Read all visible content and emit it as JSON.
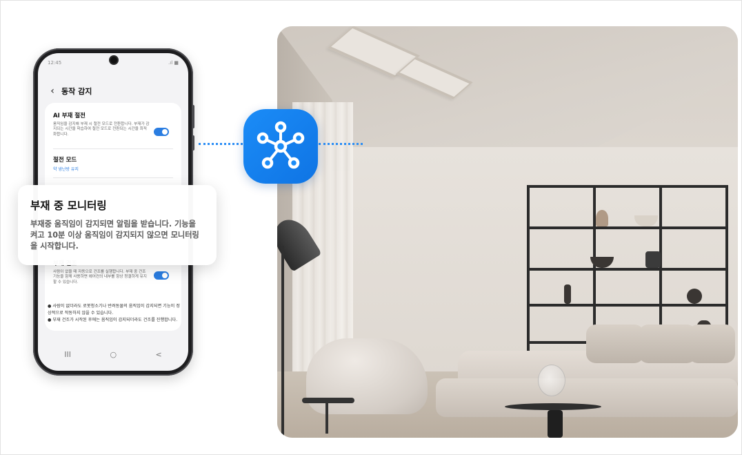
{
  "phone": {
    "status_time": "12:45",
    "status_icons": ".ıl ■",
    "header_title": "동작 감지",
    "ai_saving": {
      "title": "AI 부재 절전",
      "desc": "움직임을 감지해 부재 시 절전 모드로 전환합니다. 부재가 감지되는 시간을 학습하여 절전 모드로 전환되는 시간을 최적화합니다.",
      "toggle_on": true
    },
    "saving_mode": {
      "title": "절전 모드",
      "sub": "약 냉난방 유지"
    },
    "auto_dry": {
      "title": "부재 건조",
      "desc": "사람이 없을 때 자동으로 건조를 실행합니다. 부재 중 건조 기능을 함께 사용하면 에어컨의 내부를 항상 청결하게 유지할 수 있습니다.",
      "toggle_on": true
    },
    "notes": [
      "● 사람이 없더라도 로봇청소기나 반려동물의 움직임이 감지되면 기능이 정상적으로 작동하지 않을 수 있습니다.",
      "● 부재 건조가 시작된 후에는 움직임이 감지되더라도 건조를 진행합니다."
    ],
    "nav": {
      "recent": "III",
      "home": "○",
      "back": "<"
    }
  },
  "callout": {
    "title": "부재 중 모니터링",
    "body": "부재중 움직임이 감지되면 알림을 받습니다. 기능을 켜고 10분 이상 움직임이 감지되지 않으면 모니터링을 시작합니다."
  },
  "icons": {
    "hub": "smartthings-hub-icon",
    "back": "chevron-left-icon"
  },
  "colors": {
    "accent": "#1b8cf7",
    "toggle": "#2a7de1"
  }
}
